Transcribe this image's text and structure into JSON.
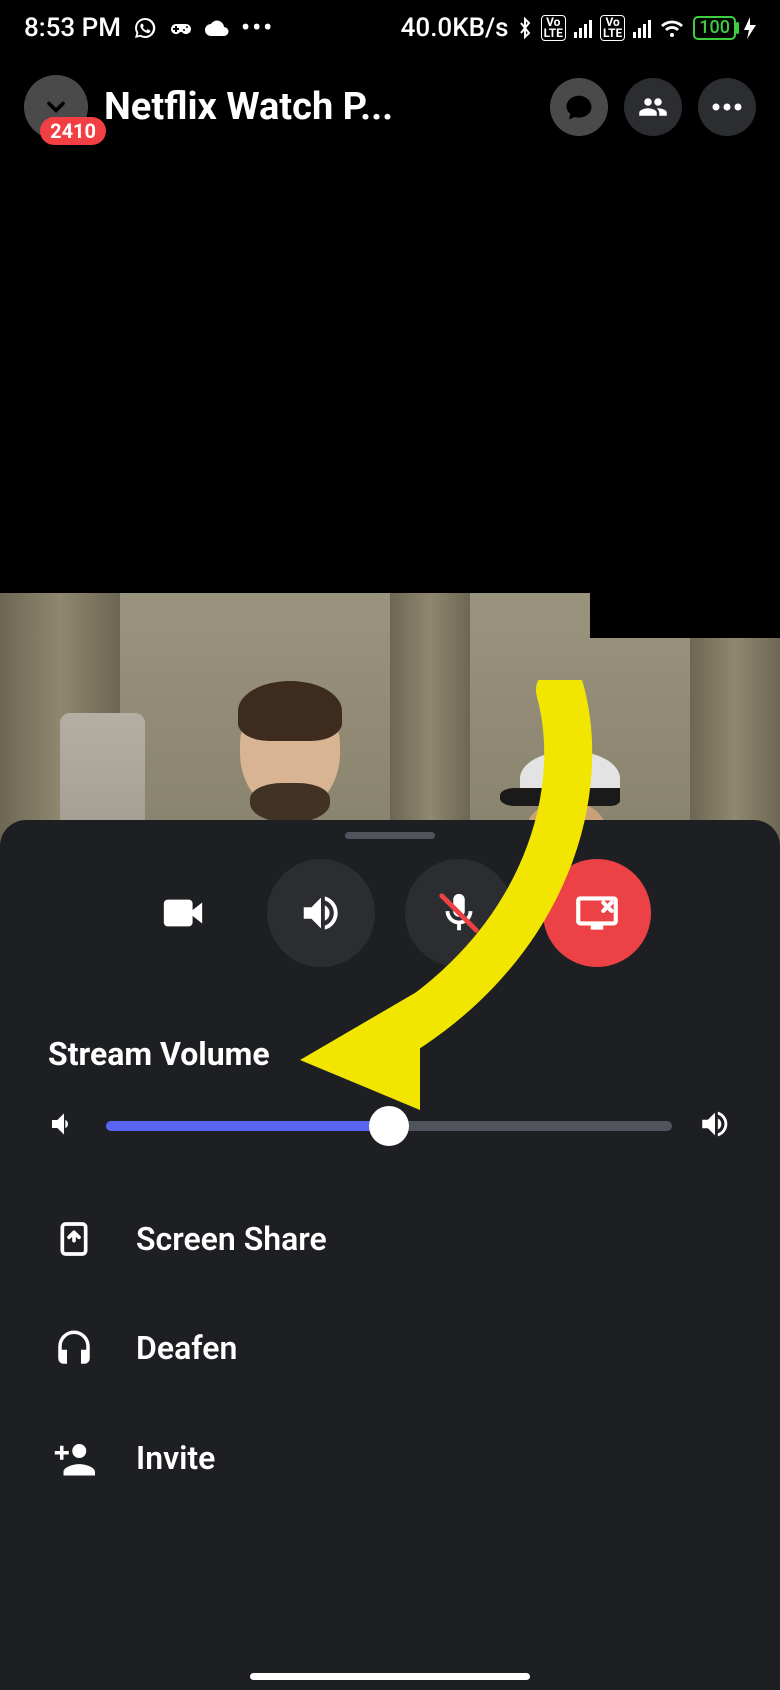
{
  "statusBar": {
    "time": "8:53 PM",
    "netSpeed": "40.0KB/s",
    "battery": "100",
    "lteBadge": "Vo\nLTE"
  },
  "header": {
    "badgeCount": "2410",
    "title": "Netflix Watch P..."
  },
  "sheet": {
    "volumeLabel": "Stream Volume",
    "volumePercent": 50,
    "menu": {
      "screenShare": "Screen Share",
      "deafen": "Deafen",
      "invite": "Invite"
    }
  }
}
